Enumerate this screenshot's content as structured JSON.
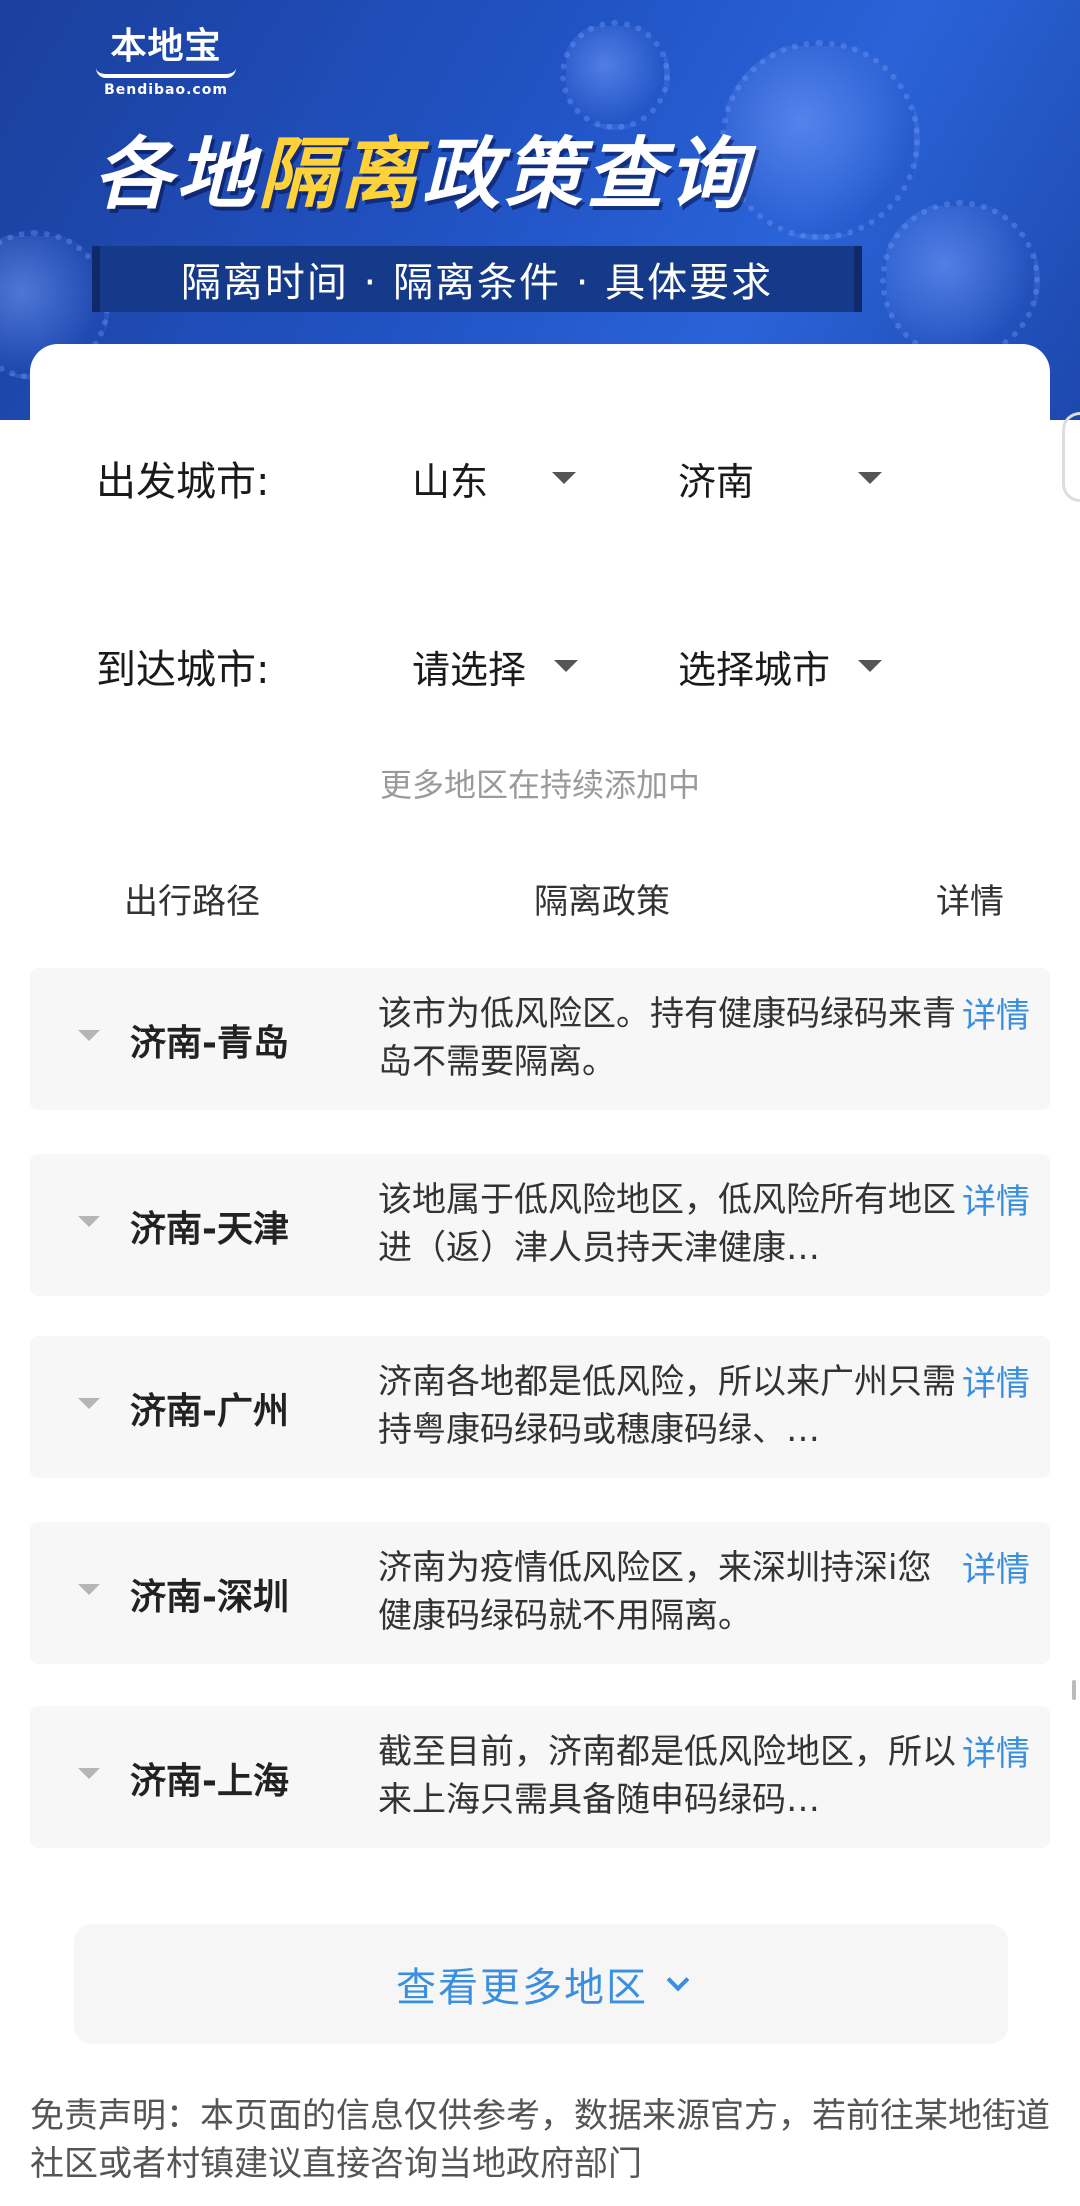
{
  "banner": {
    "logo_main": "本地宝",
    "logo_sub": "Bendibao.com",
    "title_part1": "各地",
    "title_highlight": "隔离",
    "title_part2": "政策查询",
    "subtitle": "隔离时间 · 隔离条件 · 具体要求"
  },
  "departure": {
    "label": "出发城市:",
    "province": "山东",
    "city": "济南"
  },
  "arrival": {
    "label": "到达城市:",
    "province_placeholder": "请选择",
    "city_placeholder": "选择城市"
  },
  "more_note": "更多地区在持续添加中",
  "table": {
    "headers": {
      "route": "出行路径",
      "policy": "隔离政策",
      "detail": "详情"
    },
    "rows": [
      {
        "route": "济南-青岛",
        "policy": "该市为低风险区。持有健康码绿码来青岛不需要隔离。",
        "detail": "详情"
      },
      {
        "route": "济南-天津",
        "policy": "该地属于低风险地区，低风险所有地区进（返）津人员持天津健康…",
        "detail": "详情"
      },
      {
        "route": "济南-广州",
        "policy": "济南各地都是低风险，所以来广州只需持粤康码绿码或穗康码绿、…",
        "detail": "详情"
      },
      {
        "route": "济南-深圳",
        "policy": "济南为疫情低风险区，来深圳持深i您健康码绿码就不用隔离。",
        "detail": "详情"
      },
      {
        "route": "济南-上海",
        "policy": "截至目前，济南都是低风险地区，所以来上海只需具备随申码绿码…",
        "detail": "详情"
      }
    ]
  },
  "view_more": "查看更多地区",
  "disclaimer": "免责声明：本页面的信息仅供参考，数据来源官方，若前往某地街道社区或者村镇建议直接咨询当地政府部门",
  "colors": {
    "accent": "#3a8fe0",
    "banner": "#2153c4",
    "highlight": "#ffd23a"
  }
}
